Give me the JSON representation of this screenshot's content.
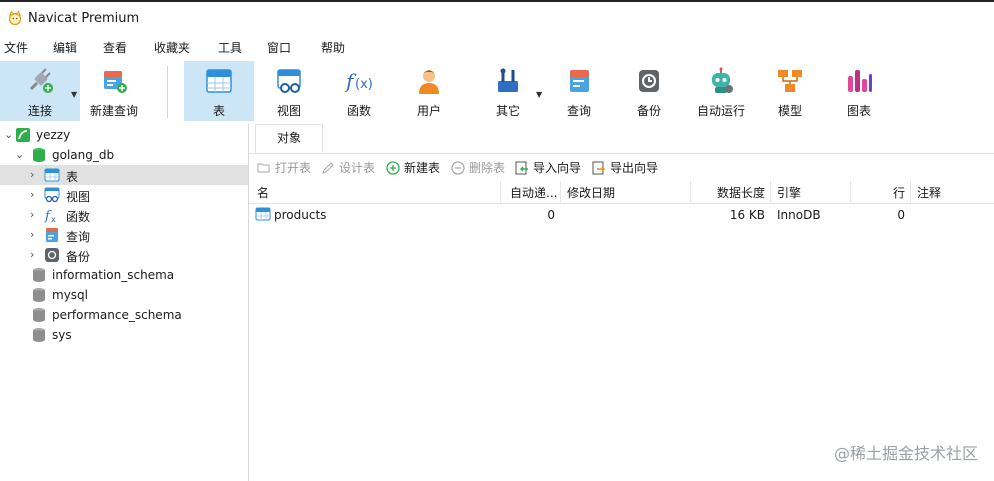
{
  "window": {
    "title": "Navicat Premium"
  },
  "menu": [
    "文件",
    "编辑",
    "查看",
    "收藏夹",
    "工具",
    "窗口",
    "帮助"
  ],
  "toolbar": {
    "connect": "连接",
    "new_query": "新建查询",
    "table": "表",
    "view": "视图",
    "function": "函数",
    "user": "用户",
    "other": "其它",
    "query": "查询",
    "backup": "备份",
    "automation": "自动运行",
    "model": "模型",
    "chart": "图表"
  },
  "tree": {
    "connection": "yezzy",
    "database": "golang_db",
    "nodes": {
      "tables": "表",
      "views": "视图",
      "functions": "函数",
      "queries": "查询",
      "backups": "备份"
    },
    "other_dbs": [
      "information_schema",
      "mysql",
      "performance_schema",
      "sys"
    ]
  },
  "tabs": {
    "objects": "对象"
  },
  "object_toolbar": {
    "open_table": "打开表",
    "design_table": "设计表",
    "new_table": "新建表",
    "delete_table": "删除表",
    "import_wizard": "导入向导",
    "export_wizard": "导出向导"
  },
  "grid": {
    "columns": {
      "name": "名",
      "auto_increment": "自动递...",
      "modified": "修改日期",
      "data_length": "数据长度",
      "engine": "引擎",
      "rows": "行",
      "comment": "注释"
    },
    "rows": [
      {
        "name": "products",
        "auto_increment": "0",
        "modified": "",
        "data_length": "16 KB",
        "engine": "InnoDB",
        "rows": "0",
        "comment": ""
      }
    ]
  },
  "watermark": "@稀土掘金技术社区",
  "colors": {
    "selection": "#cde6f7",
    "tree_selection": "#e1e1e1",
    "table_icon": "#2f8fd8"
  }
}
